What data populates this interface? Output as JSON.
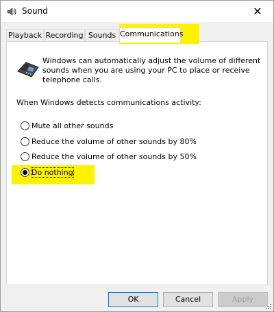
{
  "window": {
    "title": "Sound",
    "close_glyph": "✕"
  },
  "tabs": [
    {
      "label": "Playback",
      "active": false
    },
    {
      "label": "Recording",
      "active": false
    },
    {
      "label": "Sounds",
      "active": false
    },
    {
      "label": "Communications",
      "active": true
    }
  ],
  "panel": {
    "description": "Windows can automatically adjust the volume of different sounds when you are using your PC to place or receive telephone calls.",
    "detect_label": "When Windows detects communications activity:",
    "options": [
      {
        "label": "Mute all other sounds",
        "checked": false
      },
      {
        "label": "Reduce the volume of other sounds by 80%",
        "checked": false
      },
      {
        "label": "Reduce the volume of other sounds by 50%",
        "checked": false
      },
      {
        "label": "Do nothing",
        "checked": true
      }
    ]
  },
  "buttons": {
    "ok": "OK",
    "cancel": "Cancel",
    "apply": "Apply"
  },
  "colors": {
    "highlight": "#fff200",
    "focus_border": "#0078d7"
  },
  "icons": {
    "title": "speaker-icon",
    "panel": "telephone-icon",
    "close": "close-icon"
  }
}
